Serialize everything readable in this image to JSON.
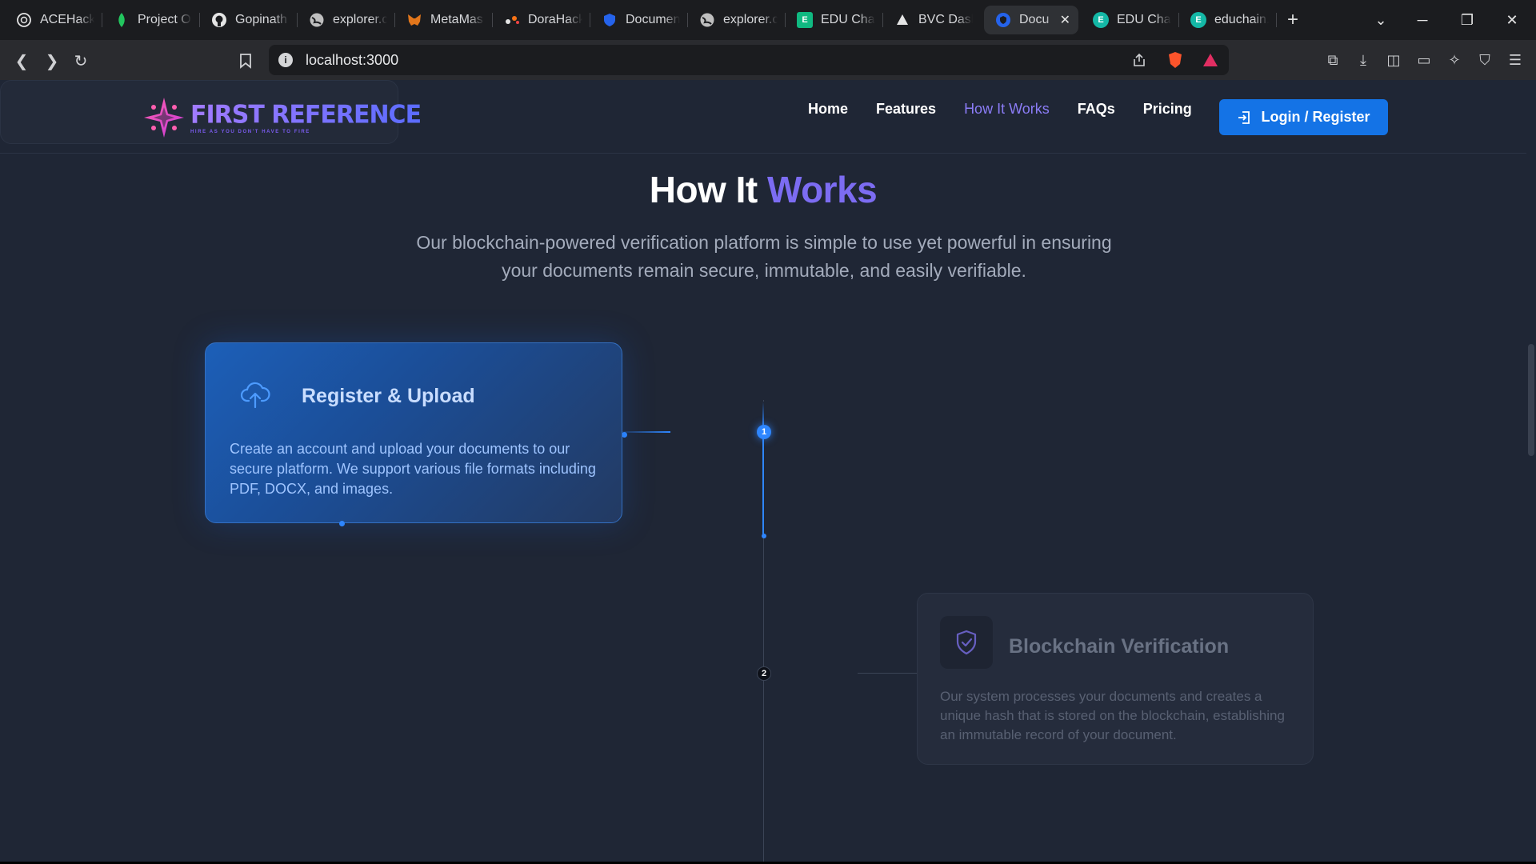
{
  "browser": {
    "tabs": [
      {
        "title": "ACEHack",
        "icon": "openai-icon",
        "color": "#e5e5e5"
      },
      {
        "title": "Project O",
        "icon": "leaf-icon",
        "color": "#22c55e"
      },
      {
        "title": "Gopinath",
        "icon": "github-icon",
        "color": "#e5e5e5"
      },
      {
        "title": "explorer.c",
        "icon": "globe-icon",
        "color": "#bfbfbf"
      },
      {
        "title": "MetaMas",
        "icon": "metamask-icon",
        "color": "#e2761b"
      },
      {
        "title": "DoraHack",
        "icon": "dorahacks-icon",
        "color": "#f97316"
      },
      {
        "title": "Documen",
        "icon": "shield-icon",
        "color": "#2563eb"
      },
      {
        "title": "explorer.c",
        "icon": "globe-icon",
        "color": "#bfbfbf"
      },
      {
        "title": "EDU Chai",
        "icon": "edu-chain-icon",
        "color": "#10b981"
      },
      {
        "title": "BVC Dash",
        "icon": "triangle-icon",
        "color": "#e5e5e5"
      },
      {
        "title": "Docu",
        "icon": "shield-icon",
        "color": "#2563eb",
        "active": true
      },
      {
        "title": "EDU Chai",
        "icon": "edu-chain-icon",
        "color": "#14b8a6"
      },
      {
        "title": "educhain.",
        "icon": "edu-chain-icon",
        "color": "#14b8a6"
      }
    ],
    "url": "localhost:3000"
  },
  "site": {
    "brand_name": "FIRST REFERENCE",
    "brand_tagline": "HIRE AS YOU DON'T HAVE TO FIRE",
    "nav": [
      "Home",
      "Features",
      "How It Works",
      "FAQs",
      "Pricing"
    ],
    "current_nav": "How It Works",
    "login_label": "Login / Register"
  },
  "section": {
    "title_part1": "How It",
    "title_part2": "Works",
    "subtitle": "Our blockchain-powered verification platform is simple to use yet powerful in ensuring your documents remain secure, immutable, and easily verifiable."
  },
  "steps": [
    {
      "number": "1",
      "title": "Register & Upload",
      "icon": "cloud-upload-icon",
      "description": "Create an account and upload your documents to our secure platform. We support various file formats including PDF, DOCX, and images."
    },
    {
      "number": "2",
      "title": "Blockchain Verification",
      "icon": "shield-check-icon",
      "description": "Our system processes your documents and creates a unique hash that is stored on the blockchain, establishing an immutable record of your document."
    }
  ],
  "colors": {
    "accent": "#7c6cf2",
    "primary_button": "#1473e6",
    "timeline_active": "#2e86ff",
    "page_background": "#1f2635"
  }
}
